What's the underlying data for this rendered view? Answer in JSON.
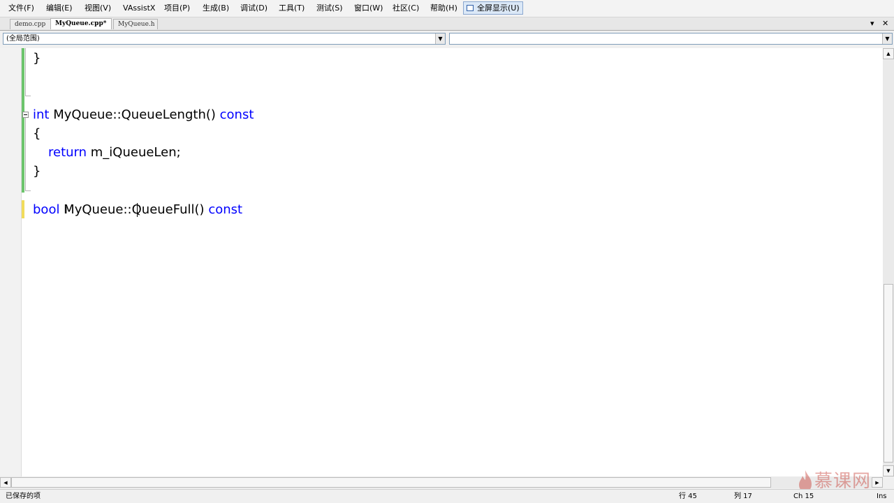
{
  "menu": {
    "items": [
      "文件(F)",
      "编辑(E)",
      "视图(V)",
      "VAssistX",
      "项目(P)",
      "生成(B)",
      "调试(D)",
      "工具(T)",
      "测试(S)",
      "窗口(W)",
      "社区(C)",
      "帮助(H)"
    ],
    "fullscreen_label": "全屏显示(U)"
  },
  "tabs": [
    "demo.cpp",
    "MyQueue.cpp*",
    "MyQueue.h"
  ],
  "tab_controls": {
    "dropdown": "▾",
    "close": "✕"
  },
  "nav": {
    "scope": "(全局范围)",
    "member": "",
    "arrow": "▼"
  },
  "code": {
    "line1_brace": "}",
    "line2_kw_int": "int",
    "line2_rest": " MyQueue::QueueLength() ",
    "line2_kw_const": "const",
    "line3_brace": "{",
    "line4_kw_return": "return",
    "line4_rest": " m_iQueueLen;",
    "line5_brace": "}",
    "line6_kw_bool": "bool",
    "line6_rest": " MyQueue::QueueFull() ",
    "line6_kw_const": "const"
  },
  "scroll": {
    "up": "▲",
    "down": "▼",
    "left": "◀",
    "right": "▶"
  },
  "status": {
    "message": "已保存的项",
    "line": "行 45",
    "col": "列 17",
    "ch": "Ch 15",
    "mode": "Ins"
  },
  "watermark": {
    "text": "慕课网"
  }
}
